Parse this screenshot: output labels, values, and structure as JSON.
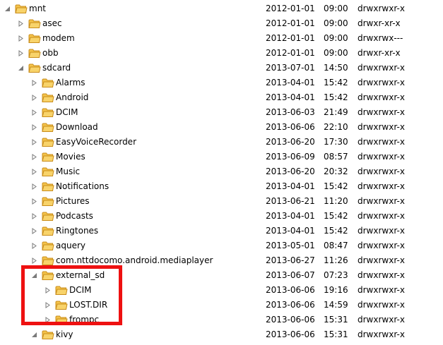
{
  "colors": {
    "folder_body": "#F4C34A",
    "folder_edge": "#C98C1A",
    "highlight": "#EE1111",
    "toggle": "#7A7A7A"
  },
  "tree": {
    "rows": [
      {
        "name": "mnt",
        "date": "2012-01-01",
        "time": "09:00",
        "perm": "drwxrwxr-x",
        "depth": 0,
        "expanded": true
      },
      {
        "name": "asec",
        "date": "2012-01-01",
        "time": "09:00",
        "perm": "drwxr-xr-x",
        "depth": 1,
        "expanded": false
      },
      {
        "name": "modem",
        "date": "2012-01-01",
        "time": "09:00",
        "perm": "drwxrwx---",
        "depth": 1,
        "expanded": false
      },
      {
        "name": "obb",
        "date": "2012-01-01",
        "time": "09:00",
        "perm": "drwxr-xr-x",
        "depth": 1,
        "expanded": false
      },
      {
        "name": "sdcard",
        "date": "2013-07-01",
        "time": "14:50",
        "perm": "drwxrwxr-x",
        "depth": 1,
        "expanded": true
      },
      {
        "name": "Alarms",
        "date": "2013-04-01",
        "time": "15:42",
        "perm": "drwxrwxr-x",
        "depth": 2,
        "expanded": false
      },
      {
        "name": "Android",
        "date": "2013-04-01",
        "time": "15:42",
        "perm": "drwxrwxr-x",
        "depth": 2,
        "expanded": false
      },
      {
        "name": "DCIM",
        "date": "2013-06-03",
        "time": "21:49",
        "perm": "drwxrwxr-x",
        "depth": 2,
        "expanded": false
      },
      {
        "name": "Download",
        "date": "2013-06-06",
        "time": "22:10",
        "perm": "drwxrwxr-x",
        "depth": 2,
        "expanded": false
      },
      {
        "name": "EasyVoiceRecorder",
        "date": "2013-06-20",
        "time": "17:30",
        "perm": "drwxrwxr-x",
        "depth": 2,
        "expanded": false
      },
      {
        "name": "Movies",
        "date": "2013-06-09",
        "time": "08:57",
        "perm": "drwxrwxr-x",
        "depth": 2,
        "expanded": false
      },
      {
        "name": "Music",
        "date": "2013-06-20",
        "time": "20:32",
        "perm": "drwxrwxr-x",
        "depth": 2,
        "expanded": false
      },
      {
        "name": "Notifications",
        "date": "2013-04-01",
        "time": "15:42",
        "perm": "drwxrwxr-x",
        "depth": 2,
        "expanded": false
      },
      {
        "name": "Pictures",
        "date": "2013-06-21",
        "time": "11:20",
        "perm": "drwxrwxr-x",
        "depth": 2,
        "expanded": false
      },
      {
        "name": "Podcasts",
        "date": "2013-04-01",
        "time": "15:42",
        "perm": "drwxrwxr-x",
        "depth": 2,
        "expanded": false
      },
      {
        "name": "Ringtones",
        "date": "2013-04-01",
        "time": "15:42",
        "perm": "drwxrwxr-x",
        "depth": 2,
        "expanded": false
      },
      {
        "name": "aquery",
        "date": "2013-05-01",
        "time": "08:47",
        "perm": "drwxrwxr-x",
        "depth": 2,
        "expanded": false
      },
      {
        "name": "com.nttdocomo.android.mediaplayer",
        "date": "2013-06-27",
        "time": "11:26",
        "perm": "drwxrwxr-x",
        "depth": 2,
        "expanded": false
      },
      {
        "name": "external_sd",
        "date": "2013-06-07",
        "time": "07:23",
        "perm": "drwxrwxr-x",
        "depth": 2,
        "expanded": true
      },
      {
        "name": "DCIM",
        "date": "2013-06-06",
        "time": "19:16",
        "perm": "drwxrwxr-x",
        "depth": 3,
        "expanded": false
      },
      {
        "name": "LOST.DIR",
        "date": "2013-06-06",
        "time": "14:59",
        "perm": "drwxrwxr-x",
        "depth": 3,
        "expanded": false
      },
      {
        "name": "frompc",
        "date": "2013-06-06",
        "time": "15:31",
        "perm": "drwxrwxr-x",
        "depth": 3,
        "expanded": false
      },
      {
        "name": "kivy",
        "date": "2013-06-06",
        "time": "15:31",
        "perm": "drwxrwxr-x",
        "depth": 2,
        "expanded": true
      }
    ]
  }
}
